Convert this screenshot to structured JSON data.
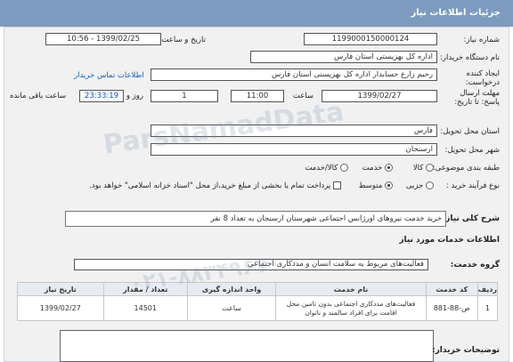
{
  "header": {
    "title": "جزئیات اطلاعات نیاز"
  },
  "fields": {
    "need_number_label": "شماره نیاز:",
    "need_number": "1199000150000124",
    "announce_label": "تاریخ و ساعت اعلان عمومی:",
    "announce_value": "1399/02/25 - 10:56",
    "buyer_org_label": "نام دستگاه خریدار:",
    "buyer_org": "اداره کل بهزیستی استان فارس",
    "requester_label": "ایجاد کننده درخواست:",
    "requester": "رحیم زارع حسابدار اداره کل بهزیستی استان فارس",
    "contact_link": "اطلاعات تماس خریدار",
    "deadline_label": "مهلت ارسال پاسخ: تا تاریخ:",
    "deadline_date": "1399/02/27",
    "time_label": "ساعت",
    "deadline_time": "11:00",
    "days_value": "1",
    "days_label": "روز و",
    "remaining_time": "23:33:19",
    "remaining_label": "ساعت باقی مانده",
    "province_label": "استان محل تحویل:",
    "province": "فارس",
    "city_label": "شهر محل تحویل:",
    "city": "ارسنجان",
    "category_label": "طبقه بندی موضوعی:",
    "category_options": [
      "کالا",
      "خدمت",
      "کالا/خدمت"
    ],
    "process_label": "نوع فرآیند خرید :",
    "process_options": [
      "جزیی",
      "متوسط"
    ],
    "treasury_note": "پرداخت تمام یا بخشی از مبلغ خرید،از محل \"اسناد خزانه اسلامی\" خواهد بود."
  },
  "summary": {
    "label": "شرح کلی نیاز:",
    "text": "خرید خدمت نیروهای اورژانس اجتماعی شهرستان ارسنجان به تعداد 8 نفر"
  },
  "services_section": {
    "title": "اطلاعات خدمات مورد نیاز",
    "group_label": "گروه خدمت:",
    "group_value": "فعالیت‌های مربوط به سلامت انسان و مددکاری اجتماعی"
  },
  "table": {
    "headers": [
      "ردیف",
      "کد خدمت",
      "نام خدمت",
      "واحد اندازه گیری",
      "تعداد / مقدار",
      "تاریخ نیاز"
    ],
    "rows": [
      [
        "1",
        "ص-88-881",
        "فعالیت‌های مددکاری اجتماعی بدون تامین محل اقامت برای افراد سالمند و ناتوان",
        "ساعت",
        "14501",
        "1399/02/27"
      ]
    ]
  },
  "buyer_notes_label": "توضیحات خریدار:",
  "watermark": {
    "line1": "ParsNamadData",
    "line2": "۰۲۱-۸۸۳۴۹۶۷۰"
  }
}
